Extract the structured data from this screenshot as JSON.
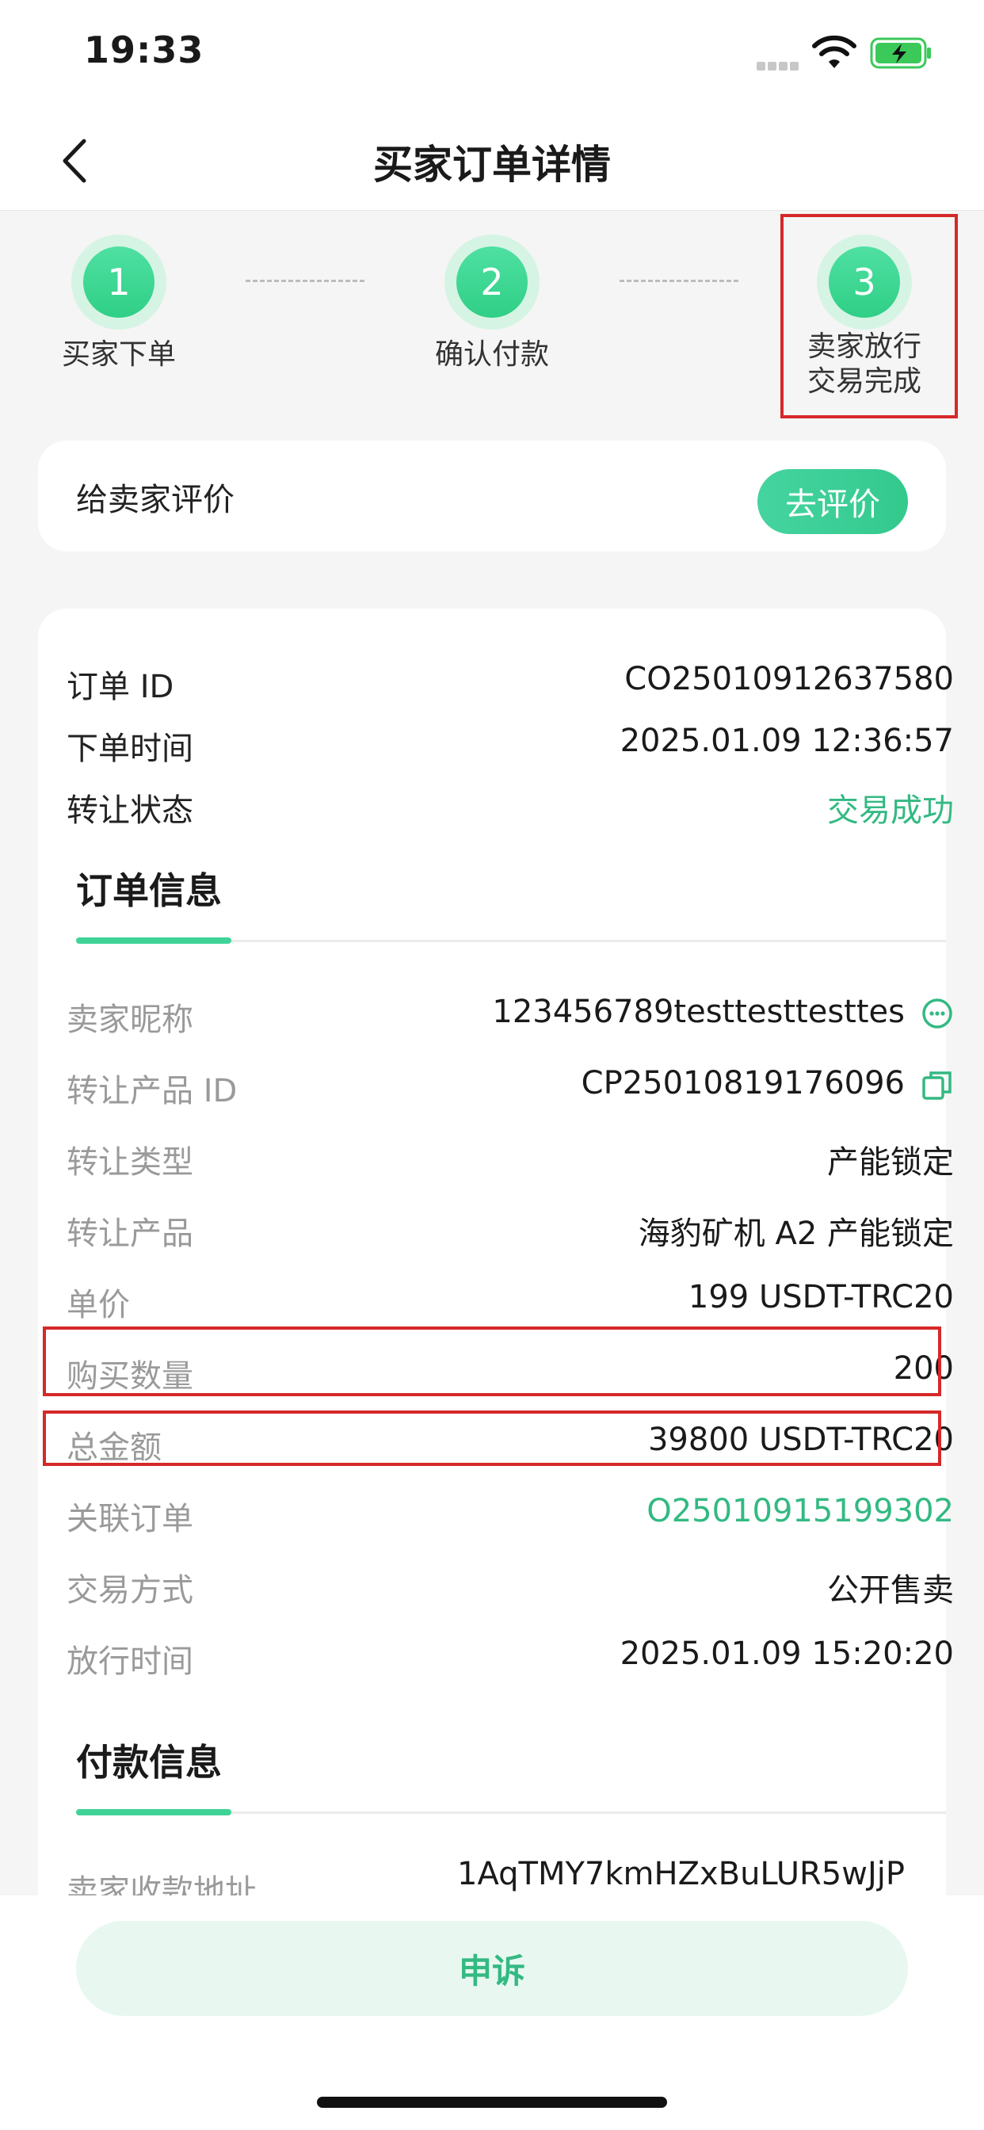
{
  "status_bar": {
    "time": "19:33"
  },
  "nav": {
    "title": "买家订单详情"
  },
  "stepper": [
    {
      "number": "1",
      "label": "买家下单"
    },
    {
      "number": "2",
      "label": "确认付款"
    },
    {
      "number": "3",
      "label": "卖家放行\n交易完成"
    }
  ],
  "review": {
    "label": "给卖家评价",
    "button": "去评价"
  },
  "summary": [
    {
      "key": "订单 ID",
      "value": "CO25010912637580"
    },
    {
      "key": "下单时间",
      "value": "2025.01.09 12:36:57"
    },
    {
      "key": "转让状态",
      "value": "交易成功"
    }
  ],
  "order_info": {
    "title": "订单信息",
    "rows": [
      {
        "key": "卖家昵称",
        "value": "123456789testtesttesttes"
      },
      {
        "key": "转让产品 ID",
        "value": "CP25010819176096"
      },
      {
        "key": "转让类型",
        "value": "产能锁定"
      },
      {
        "key": "转让产品",
        "value": "海豹矿机 A2 产能锁定"
      },
      {
        "key": "单价",
        "value": "199 USDT-TRC20"
      },
      {
        "key": "购买数量",
        "value": "200"
      },
      {
        "key": "总金额",
        "value": "39800 USDT-TRC20"
      },
      {
        "key": "关联订单",
        "value": "O25010915199302"
      },
      {
        "key": "交易方式",
        "value": "公开售卖"
      },
      {
        "key": "放行时间",
        "value": "2025.01.09 15:20:20"
      }
    ]
  },
  "payment_info": {
    "title": "付款信息",
    "rows": [
      {
        "key": "卖家收款地址",
        "value": "1AqTMY7kmHZxBuLUR5wJjP"
      }
    ]
  },
  "appeal": {
    "button": "申诉"
  },
  "colors": {
    "accent": "#3fd398",
    "green_text": "#33b982",
    "highlight": "#d62828"
  }
}
